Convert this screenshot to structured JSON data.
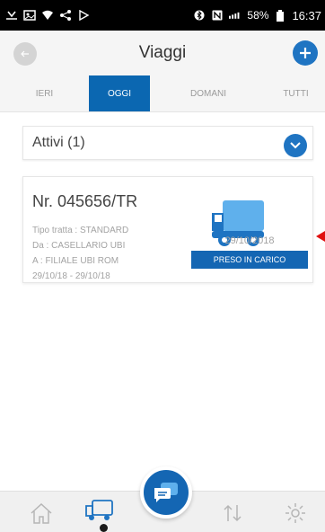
{
  "status_bar": {
    "battery": "58%",
    "time": "16:37"
  },
  "header": {
    "title": "Viaggi"
  },
  "tabs": [
    {
      "label": "IERI",
      "selected": false
    },
    {
      "label": "OGGI",
      "selected": true
    },
    {
      "label": "DOMANI",
      "selected": false
    },
    {
      "label": "TUTTI",
      "selected": false
    }
  ],
  "section": {
    "label": "Attivi (1)"
  },
  "trip_card": {
    "number": "Nr. 045656/TR",
    "route_type": "Tipo tratta : STANDARD",
    "from": "Da : CASELLARIO UBI",
    "to": "A : FILIALE UBI ROM",
    "period": "29/10/18 - 29/10/18",
    "date": "29/10/2018",
    "status": "PRESO IN CARICO"
  },
  "colors": {
    "accent": "#1f74c2",
    "active_tab": "#0b67b1",
    "marker": "#e01010"
  },
  "icons": {
    "back": "arrow-left-icon",
    "add": "plus-icon",
    "expand": "chevron-down-icon",
    "truck": "truck-icon",
    "home": "home-icon",
    "trips": "truck-icon",
    "chat": "chat-icon",
    "transfer": "transfer-icon",
    "settings": "gear-icon"
  }
}
